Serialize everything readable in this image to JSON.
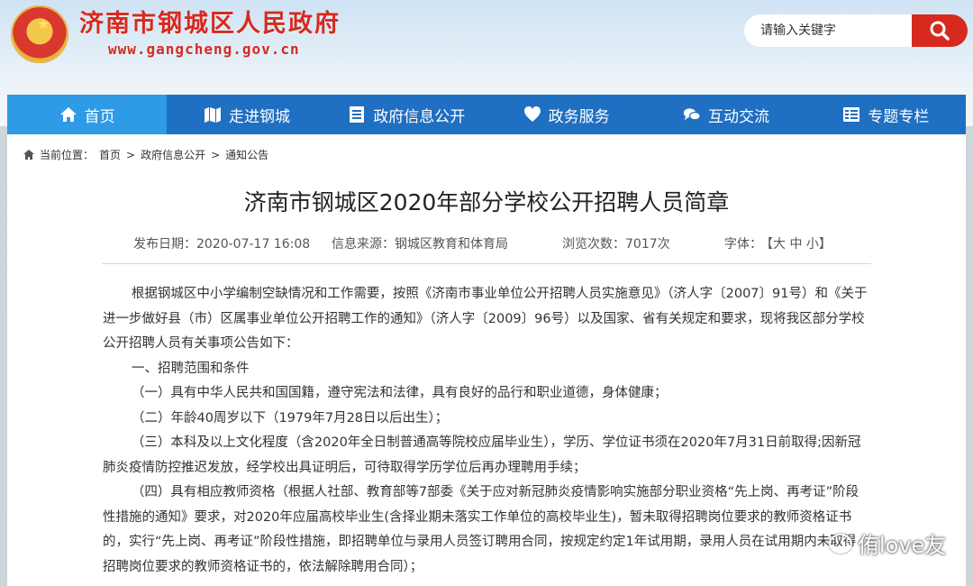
{
  "header": {
    "site_title": "济南市钢城区人民政府",
    "site_url": "www.gangcheng.gov.cn",
    "search_placeholder": "请输入关键字"
  },
  "nav": {
    "items": [
      {
        "label": "首页",
        "icon": "home-icon",
        "active": true
      },
      {
        "label": "走进钢城",
        "icon": "map-icon",
        "active": false
      },
      {
        "label": "政府信息公开",
        "icon": "list-icon",
        "active": false
      },
      {
        "label": "政务服务",
        "icon": "heart-icon",
        "active": false
      },
      {
        "label": "互动交流",
        "icon": "chat-icon",
        "active": false
      },
      {
        "label": "专题专栏",
        "icon": "column-icon",
        "active": false
      }
    ]
  },
  "breadcrumb": {
    "prefix": "当前位置：",
    "items": [
      "首页",
      "政府信息公开",
      "通知公告"
    ],
    "sep": ">"
  },
  "article": {
    "title": "济南市钢城区2020年部分学校公开招聘人员简章",
    "publish_date": "发布日期：2020-07-17 16:08",
    "source": "信息来源：钢城区教育和体育局",
    "views": "浏览次数：7017次",
    "font_label": "字体：",
    "font_sizes": "【大 中 小】",
    "paragraphs": [
      "根据钢城区中小学编制空缺情况和工作需要，按照《济南市事业单位公开招聘人员实施意见》（济人字〔2007〕91号）和《关于进一步做好县（市）区属事业单位公开招聘工作的通知》（济人字〔2009〕96号）以及国家、省有关规定和要求，现将我区部分学校公开招聘人员有关事项公告如下：",
      "一、招聘范围和条件",
      "（一）具有中华人民共和国国籍，遵守宪法和法律，具有良好的品行和职业道德，身体健康；",
      "（二）年龄40周岁以下（1979年7月28日以后出生）；",
      "（三）本科及以上文化程度（含2020年全日制普通高等院校应届毕业生），学历、学位证书须在2020年7月31日前取得;因新冠肺炎疫情防控推迟发放，经学校出具证明后，可待取得学历学位后再办理聘用手续；",
      "（四）具有相应教师资格（根据人社部、教育部等7部委《关于应对新冠肺炎疫情影响实施部分职业资格“先上岗、再考证”阶段性措施的通知》要求，对2020年应届高校毕业生(含择业期未落实工作单位的高校毕业生)，暂未取得招聘岗位要求的教师资格证书的，实行“先上岗、再考证”阶段性措施，即招聘单位与录用人员签订聘用合同，按规定约定1年试用期，录用人员在试用期内未取得招聘岗位要求的教师资格证书的，依法解除聘用合同）；"
    ]
  },
  "watermark": {
    "text": "侑love友"
  }
}
